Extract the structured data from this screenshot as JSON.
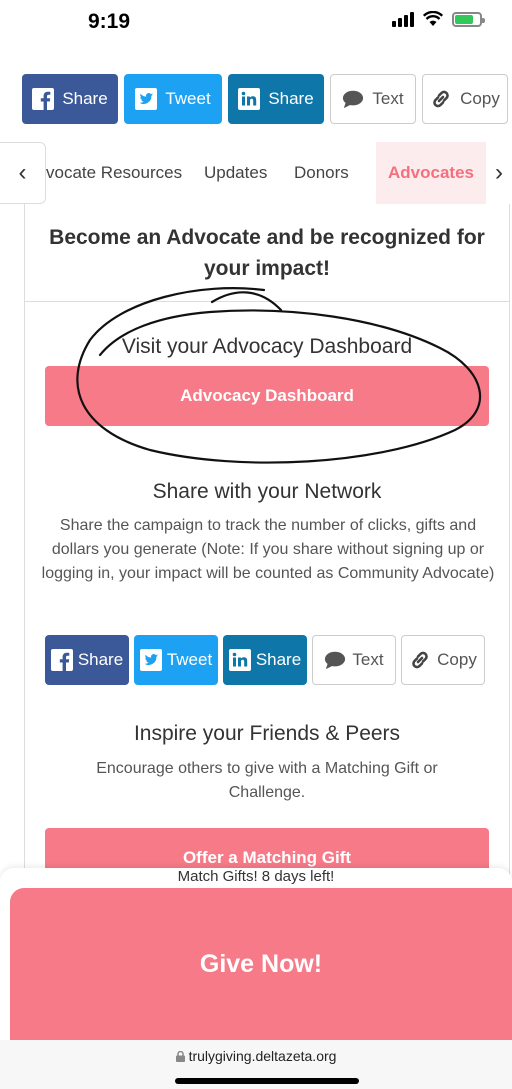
{
  "status": {
    "time": "9:19"
  },
  "top_share": {
    "facebook": "Share",
    "twitter": "Tweet",
    "linkedin": "Share",
    "text": "Text",
    "copy": "Copy"
  },
  "tabs": {
    "items": [
      "vocate Resources",
      "Updates",
      "Donors",
      "Advocates"
    ],
    "active": "Advocates"
  },
  "card": {
    "header": "Become an Advocate and be recognized for your impact!",
    "dashboard_title": "Visit your Advocacy Dashboard",
    "dashboard_button": "Advocacy Dashboard",
    "network_title": "Share with your Network",
    "network_text": "Share the campaign to track the number of clicks, gifts and dollars you generate (Note: If you share without signing up or logging in, your impact will be counted as Community Advocate)",
    "inspire_title": "Inspire your Friends & Peers",
    "inspire_text": "Encourage others to give with a Matching Gift or Challenge.",
    "matching_button": "Offer a Matching Gift"
  },
  "card_share": {
    "facebook": "Share",
    "twitter": "Tweet",
    "linkedin": "Share",
    "text": "Text",
    "copy": "Copy"
  },
  "bottom": {
    "match_text": "Match Gifts! 8 days left!",
    "give_button": "Give Now!"
  },
  "url": "trulygiving.deltazeta.org",
  "colors": {
    "accent_pink": "#f77a88",
    "facebook": "#3b5998",
    "twitter": "#1da1f2",
    "linkedin": "#0e76a8"
  }
}
